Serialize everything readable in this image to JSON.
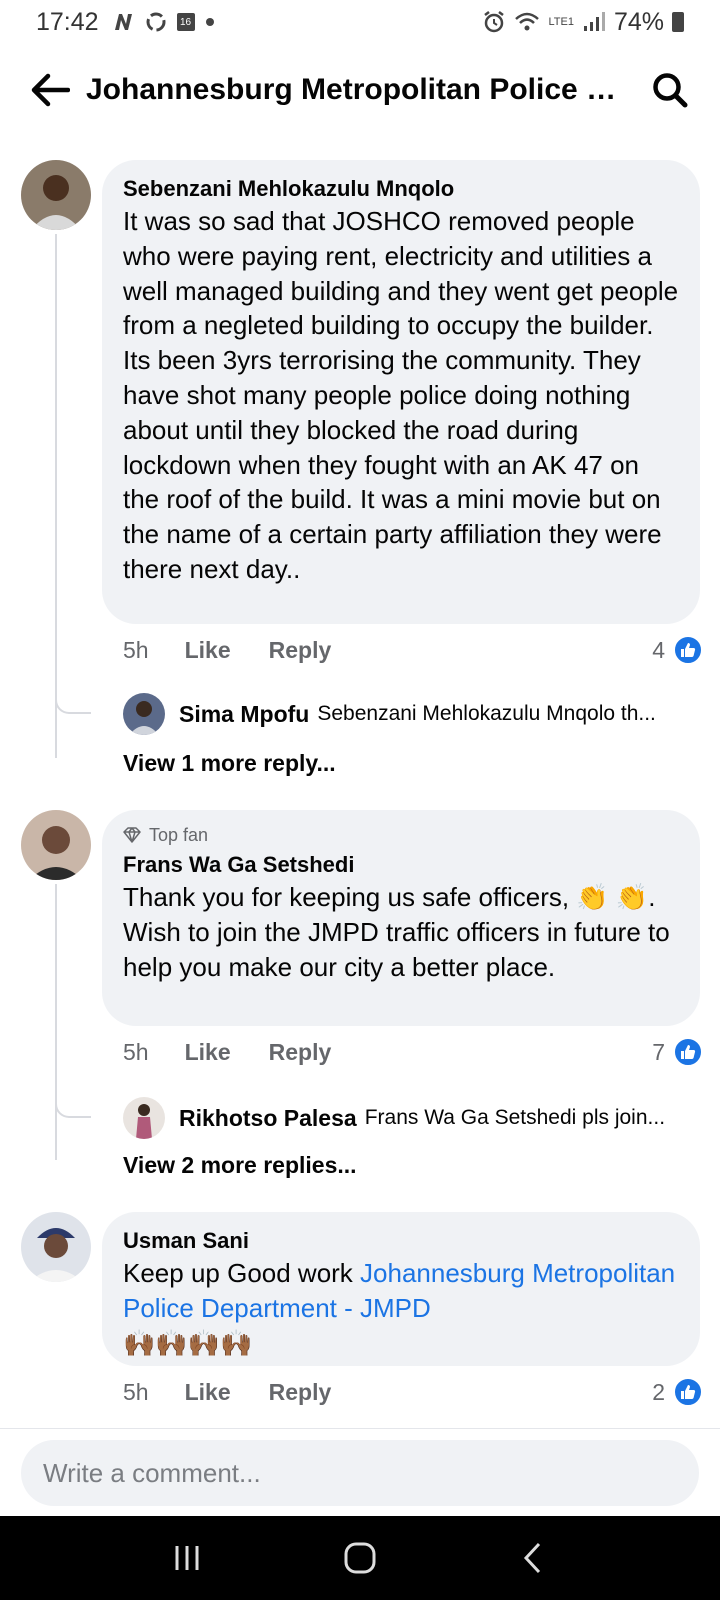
{
  "status_bar": {
    "time": "17:42",
    "calendar_badge": "16",
    "battery": "74%",
    "network": "LTE1"
  },
  "header": {
    "title": "Johannesburg Metropolitan Police Dep..."
  },
  "comments": [
    {
      "author": "Sebenzani Mehlokazulu Mnqolo",
      "text": "It was so sad that JOSHCO removed people who were paying rent, electricity and utilities a well managed building and they went get people from a negleted building to occupy the builder. Its been 3yrs terrorising the community. They have shot many people police doing  nothing about until they blocked the road during lockdown when they fought with an AK 47 on the roof of the build. It was a mini movie but on the name of a certain party affiliation they were there next day..",
      "time": "5h",
      "like": "Like",
      "reply": "Reply",
      "reactions": "4",
      "reply_preview": {
        "name": "Sima Mpofu",
        "text": "Sebenzani Mehlokazulu Mnqolo th..."
      },
      "view_more": "View 1 more reply..."
    },
    {
      "badge": "Top fan",
      "author": "Frans Wa Ga Setshedi",
      "text": "Thank you for keeping us safe officers, 👏 👏. Wish to join the JMPD traffic officers in future to help you make our city a better place.",
      "time": "5h",
      "like": "Like",
      "reply": "Reply",
      "reactions": "7",
      "reply_preview": {
        "name": "Rikhotso Palesa",
        "text": "Frans Wa Ga Setshedi pls join..."
      },
      "view_more": "View 2 more replies..."
    },
    {
      "author": "Usman Sani",
      "text_prefix": "Keep up Good work ",
      "text_link": "Johannesburg Metropolitan Police Department - JMPD",
      "text_suffix": "🙌🏾🙌🏾🙌🏾🙌🏾",
      "time": "5h",
      "like": "Like",
      "reply": "Reply",
      "reactions": "2"
    }
  ],
  "composer": {
    "placeholder": "Write a comment..."
  },
  "colors": {
    "accent": "#1b74e4",
    "bubble": "#f0f2f5",
    "muted": "#65676b"
  }
}
